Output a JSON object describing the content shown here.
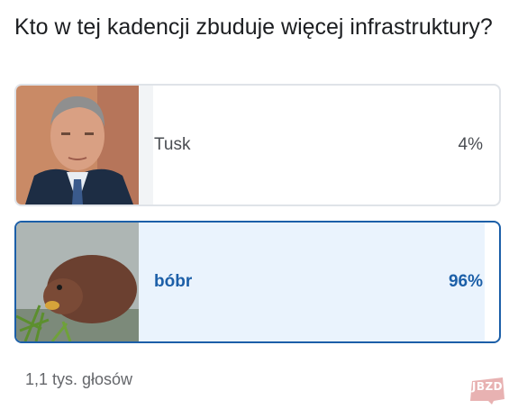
{
  "poll": {
    "question": "Kto w tej kadencji zbuduje więcej infrastruktury?",
    "options": [
      {
        "label": "Tusk",
        "percent_text": "4%",
        "percent": 4,
        "selected": false
      },
      {
        "label": "bóbr",
        "percent_text": "96%",
        "percent": 96,
        "selected": true
      }
    ],
    "votes": "1,1 tys. głosów"
  },
  "watermark": {
    "text": "JBZD"
  },
  "colors": {
    "accent": "#1c5fa8",
    "border": "#dfe3e8",
    "fill_selected": "#eaf3fd"
  },
  "icons": {
    "option_0": "man-portrait-photo",
    "option_1": "beaver-photo"
  }
}
